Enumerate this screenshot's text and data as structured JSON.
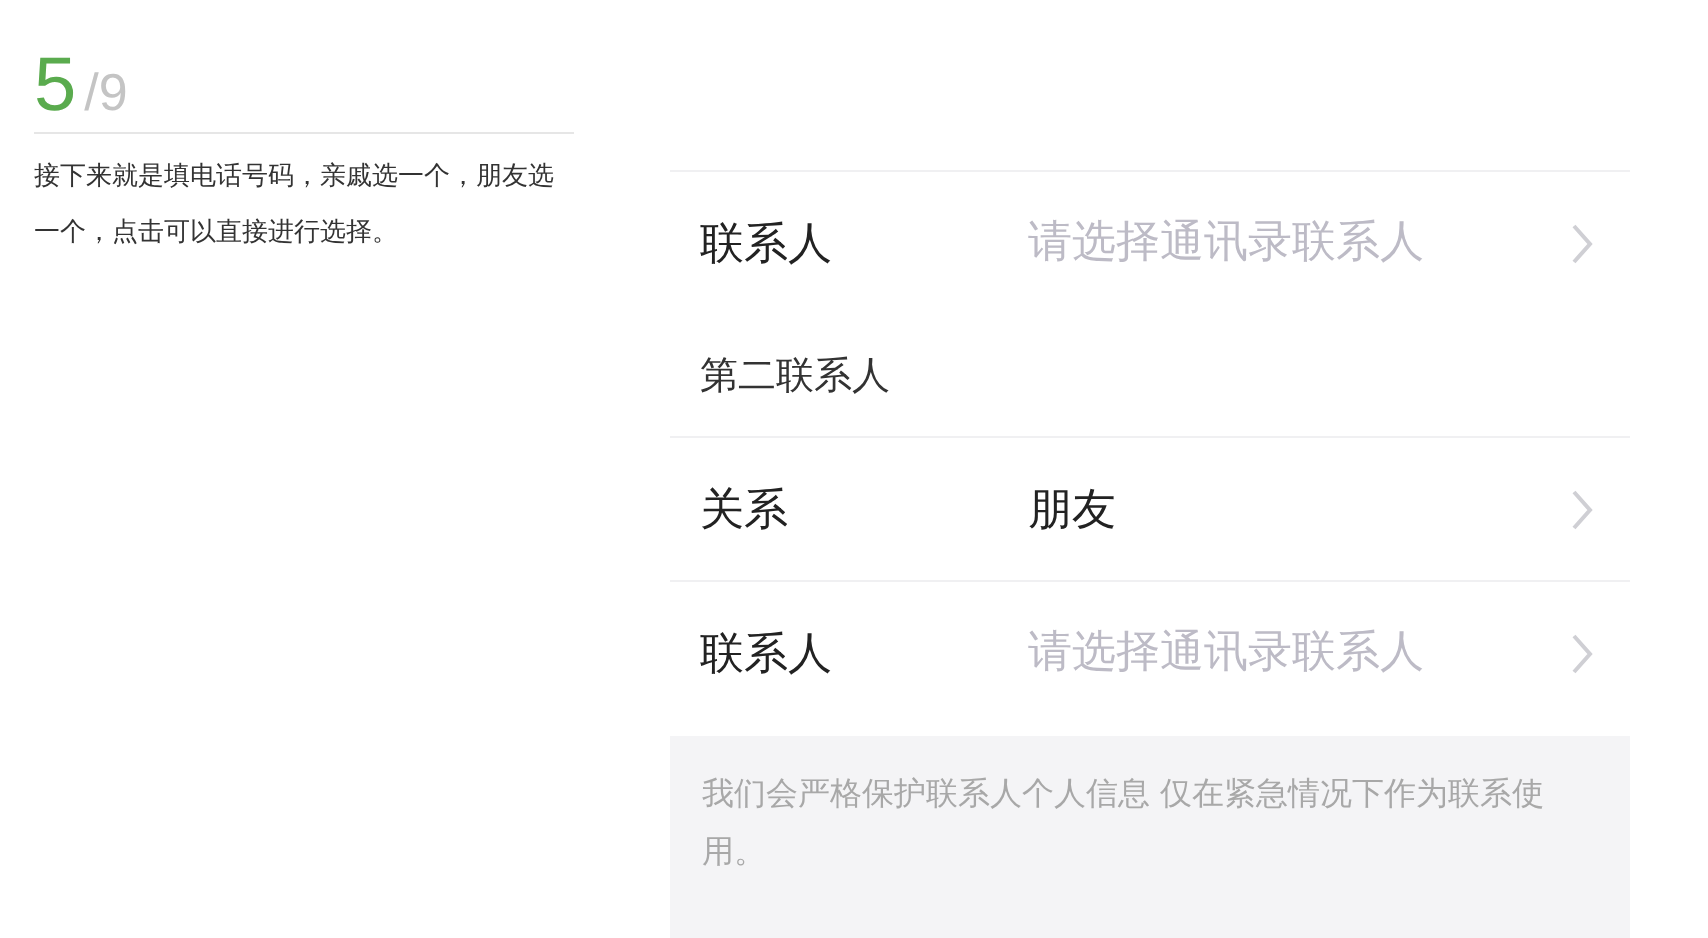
{
  "step": {
    "current": "5",
    "total": "/9"
  },
  "description": "接下来就是填电话号码，亲戚选一个，朋友选一个，点击可以直接进行选择。",
  "form": {
    "sections": [
      {
        "rows": [
          {
            "label": "联系人",
            "placeholder": "请选择通讯录联系人"
          }
        ]
      },
      {
        "title": "第二联系人",
        "rows": [
          {
            "label": "关系",
            "value": "朋友"
          },
          {
            "label": "联系人",
            "placeholder": "请选择通讯录联系人"
          }
        ]
      }
    ],
    "notice": "我们会严格保护联系人个人信息 仅在紧急情况下作为联系使用。"
  }
}
